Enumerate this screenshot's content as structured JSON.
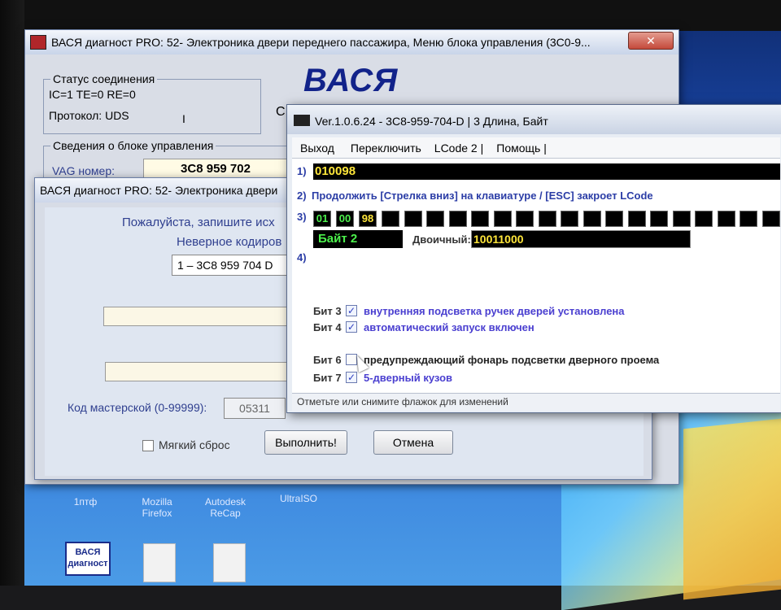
{
  "main_window": {
    "title": "ВАСЯ диагност PRO: 52- Электроника двери переднего пассажира,  Меню блока управления (3С0-9...",
    "close_label": "✕",
    "logo": "ВАСЯ",
    "connection_group_title": "Статус соединения",
    "connection_status": "IC=1  TE=0   RE=0",
    "protocol": "Протокол: UDS",
    "protocol_cursor": "I",
    "partial_letter": "С",
    "unit_group_title": "Сведения о блоке управления",
    "vag_label": "VAG номер:",
    "vag_value": "3C8 959 702"
  },
  "dialog": {
    "title": "ВАСЯ диагност PRO: 52- Электроника двери",
    "line1": "Пожалуйста, запишите исх",
    "line2": "Неверное кодиров",
    "combo_value": "1 – 3C8 959 704 D",
    "workshop_label": "Код мастерской (0-99999):",
    "workshop_value": "05311",
    "soft_reset_label": "Мягкий сброс",
    "execute_label": "Выполнить!",
    "cancel_label": "Отмена"
  },
  "lcode_window": {
    "title": "Ver.1.0.6.24 -     3C8-959-704-D | 3 Длина, Байт",
    "menu": [
      "Выход",
      "Переключить",
      "LCode 2 |",
      "Помощь |"
    ],
    "row1_num": "1)",
    "row1_value": "010098",
    "row2_num": "2)",
    "row2_text": "Продолжить [Стрелка вниз] на клавиатуре / [ESC] закроет LCode",
    "row3_num": "3)",
    "bytes": [
      "01",
      "00",
      "98"
    ],
    "byte_label": "Байт 2",
    "binary_label": "Двоичный:",
    "binary_value": "10011000",
    "row4_num": "4)",
    "bits": [
      {
        "label": "Бит 3",
        "checked": true,
        "mark": "✓",
        "desc": "внутренняя подсветка ручек дверей установлена"
      },
      {
        "label": "Бит 4",
        "checked": true,
        "mark": "✓",
        "desc": "автоматический запуск включен"
      },
      {
        "label": "Бит 6",
        "checked": false,
        "mark": "",
        "desc": "предупреждающий фонарь подсветки дверного проема"
      },
      {
        "label": "Бит 7",
        "checked": true,
        "mark": "✓",
        "desc": "5-дверный кузов"
      }
    ],
    "status": "Отметьте или снимите флажок для изменений"
  },
  "desktop": {
    "icons": [
      {
        "label": "1птф"
      },
      {
        "label": "Mozilla Firefox"
      },
      {
        "label": "Autodesk ReCap"
      },
      {
        "label": "UltraISO"
      }
    ],
    "vasya_icon_text": "ВАСЯ диагност"
  }
}
